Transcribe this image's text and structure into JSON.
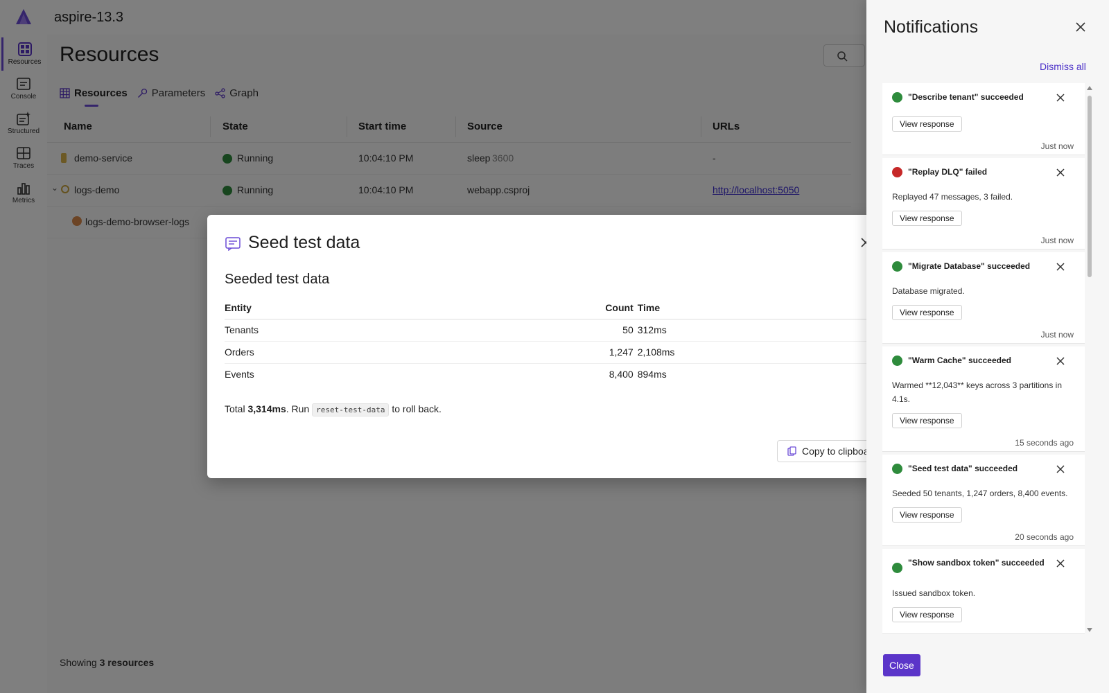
{
  "app": {
    "title": "aspire-13.3"
  },
  "sidebar": {
    "items": [
      {
        "label": "Resources",
        "icon": "grid-icon",
        "active": true
      },
      {
        "label": "Console",
        "icon": "console-icon"
      },
      {
        "label": "Structured",
        "icon": "structured-icon"
      },
      {
        "label": "Traces",
        "icon": "traces-icon"
      },
      {
        "label": "Metrics",
        "icon": "metrics-icon"
      }
    ]
  },
  "main": {
    "page_title": "Resources",
    "tabs": [
      {
        "label": "Resources",
        "icon": "table-icon",
        "active": true
      },
      {
        "label": "Parameters",
        "icon": "key-icon"
      },
      {
        "label": "Graph",
        "icon": "graph-icon"
      }
    ],
    "columns": [
      "Name",
      "State",
      "Start time",
      "Source",
      "URLs"
    ],
    "rows": [
      {
        "name": "demo-service",
        "state": "Running",
        "start": "10:04:10 PM",
        "source": "sleep",
        "source_arg": "3600",
        "url": "-"
      },
      {
        "name": "logs-demo",
        "state": "Running",
        "start": "10:04:10 PM",
        "source": "webapp.csproj",
        "source_arg": "",
        "url": "http://localhost:5050"
      },
      {
        "name": "logs-demo-browser-logs",
        "state": "",
        "start": "",
        "source": "",
        "source_arg": "",
        "url": ""
      }
    ],
    "footer_prefix": "Showing",
    "footer_count": "3 resources"
  },
  "dialog": {
    "title": "Seed test data",
    "subtitle": "Seeded test data",
    "table_headers": {
      "entity": "Entity",
      "count": "Count",
      "time": "Time"
    },
    "table_rows": [
      {
        "entity": "Tenants",
        "count": "50",
        "time": "312ms"
      },
      {
        "entity": "Orders",
        "count": "1,247",
        "time": "2,108ms"
      },
      {
        "entity": "Events",
        "count": "8,400",
        "time": "894ms"
      }
    ],
    "note_prefix": "Total",
    "note_total": "3,314ms",
    "note_mid": ". Run",
    "note_code": "reset-test-data",
    "note_suffix": "to roll back.",
    "copy_label": "Copy to clipboard"
  },
  "notifications": {
    "title": "Notifications",
    "dismiss_all": "Dismiss all",
    "close_label": "Close",
    "view_label": "View response",
    "items": [
      {
        "title": "\"Describe tenant\" succeeded",
        "status": "success",
        "body": "",
        "time": "Just now"
      },
      {
        "title": "\"Replay DLQ\" failed",
        "status": "error",
        "body": "Replayed 47 messages, 3 failed.",
        "time": "Just now"
      },
      {
        "title": "\"Migrate Database\" succeeded",
        "status": "success",
        "body": "Database migrated.",
        "time": "Just now"
      },
      {
        "title": "\"Warm Cache\" succeeded",
        "status": "success",
        "body": "Warmed **12,043** keys across 3 partitions in 4.1s.",
        "time": "15 seconds ago"
      },
      {
        "title": "\"Seed test data\" succeeded",
        "status": "success",
        "body": "Seeded 50 tenants, 1,247 orders, 8,400 events.",
        "time": "20 seconds ago"
      },
      {
        "title": "\"Show sandbox token\" succeeded",
        "status": "success",
        "body": "Issued sandbox token.",
        "time": ""
      }
    ]
  },
  "colors": {
    "accent": "#5b35c9",
    "success": "#2e8b3c",
    "error": "#c62828",
    "link": "#3a2bd1"
  }
}
